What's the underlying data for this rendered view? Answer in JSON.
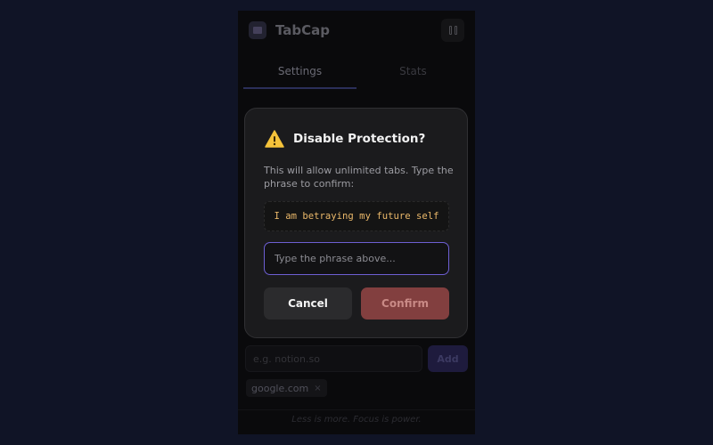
{
  "app": {
    "title": "TabCap"
  },
  "tabs": [
    {
      "label": "Settings"
    },
    {
      "label": "Stats"
    }
  ],
  "domain_input": {
    "placeholder": "e.g. notion.so"
  },
  "add_button": {
    "label": "Add"
  },
  "blocked_sites": [
    {
      "domain": "google.com",
      "remove_glyph": "×"
    }
  ],
  "footer": {
    "text": "Less is more. Focus is power."
  },
  "modal": {
    "title": "Disable Protection?",
    "description": "This will allow unlimited tabs. Type the phrase to confirm:",
    "phrase": "I am betraying my future self",
    "input_placeholder": "Type the phrase above...",
    "cancel_label": "Cancel",
    "confirm_label": "Confirm"
  },
  "colors": {
    "background": "#101426",
    "modal_bg": "#1b1b1d",
    "accent": "#6d5fd3",
    "phrase": "#eab86a",
    "danger": "#823f3f",
    "warning": "#f5c33b"
  },
  "icons": [
    "app-logo-icon",
    "pause-icon",
    "warning-icon",
    "close-icon"
  ]
}
